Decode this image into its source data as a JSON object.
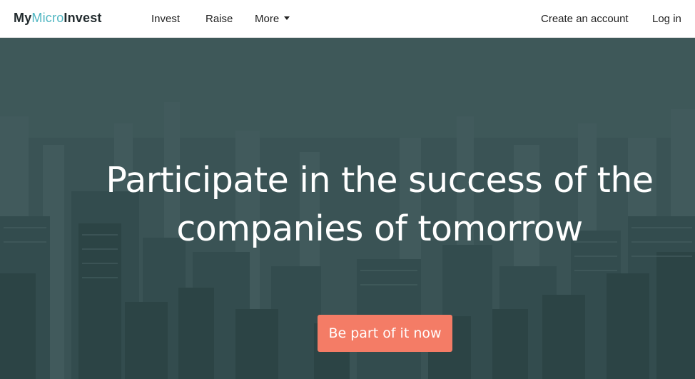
{
  "navbar": {
    "logo": {
      "part1": "My",
      "part2": "Micro",
      "part3": "Invest"
    },
    "links": {
      "invest": "Invest",
      "raise": "Raise",
      "more": "More",
      "create_account": "Create an account",
      "login": "Log in"
    },
    "more_icon": "caret-down-icon"
  },
  "hero": {
    "headline_line1": "Participate in the success of the",
    "headline_line2": "companies of tomorrow",
    "cta_label": "Be part of it now",
    "background": "city-skyline-aerial-photo"
  },
  "colors": {
    "accent": "#f47c66",
    "logo_accent": "#4fb6c2",
    "hero_tint": "#3f5556",
    "text_dark": "#222222",
    "text_light": "#ffffff"
  }
}
